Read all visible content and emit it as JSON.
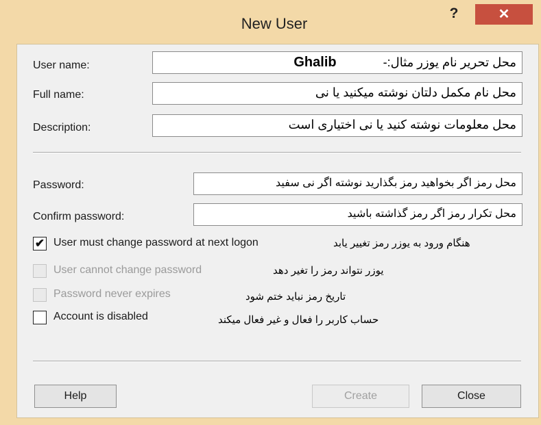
{
  "window": {
    "title": "New User",
    "help_glyph": "?",
    "close_glyph": "✕",
    "title_bar_color": "#f3d9a8",
    "close_color": "#c7503f"
  },
  "fields": {
    "user_name": {
      "label": "User name:",
      "value_latin": "Ghalib",
      "value_note": "محل تحریر نام یوزر مثال:-"
    },
    "full_name": {
      "label": "Full name:",
      "value": "محل نام مکمل دلتان نوشته میکنید یا نی"
    },
    "description": {
      "label": "Description:",
      "value": "محل معلومات نوشته کنید یا نی اختیاری است"
    },
    "password": {
      "label": "Password:",
      "value": "محل رمز اگر بخواهید رمز بگذارید نوشته اگر نی سفید"
    },
    "confirm_password": {
      "label": "Confirm password:",
      "value": "محل تکرار رمز اگر رمز گذاشته باشید"
    }
  },
  "options": [
    {
      "label": "User must change password at next logon",
      "checked": true,
      "enabled": true,
      "note": "هنگام ورود به یوزر رمز تغییر یابد",
      "check_glyph": "✔"
    },
    {
      "label": "User cannot change password",
      "checked": false,
      "enabled": false,
      "note": "یوزر نتواند رمز را تغیر دهد",
      "check_glyph": ""
    },
    {
      "label": "Password never expires",
      "checked": false,
      "enabled": false,
      "note": "تاریخ رمز نباید ختم شود",
      "check_glyph": ""
    },
    {
      "label": "Account is disabled",
      "checked": false,
      "enabled": true,
      "note": "حساب کاربر را فعال و غیر فعال میکند",
      "check_glyph": ""
    }
  ],
  "buttons": {
    "help": "Help",
    "create": "Create",
    "close": "Close"
  }
}
